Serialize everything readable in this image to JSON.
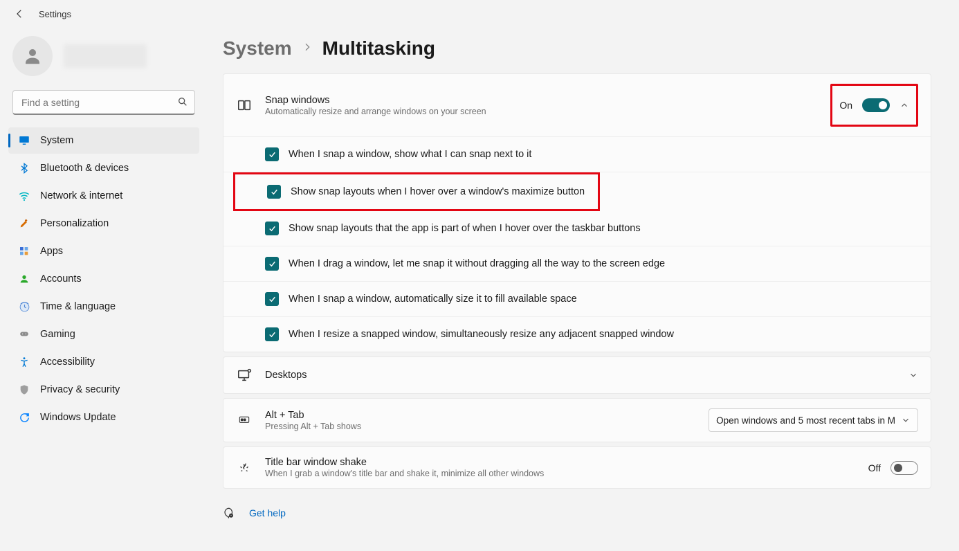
{
  "app_title": "Settings",
  "search_placeholder": "Find a setting",
  "breadcrumb": {
    "parent": "System",
    "current": "Multitasking"
  },
  "sidebar": {
    "items": [
      {
        "label": "System",
        "icon": "display-icon",
        "color": "#0078d4",
        "active": true
      },
      {
        "label": "Bluetooth & devices",
        "icon": "bluetooth-icon",
        "color": "#0078d4"
      },
      {
        "label": "Network & internet",
        "icon": "wifi-icon",
        "color": "#00b7c3"
      },
      {
        "label": "Personalization",
        "icon": "brush-icon",
        "color": "#d86c00"
      },
      {
        "label": "Apps",
        "icon": "apps-icon",
        "color": "#3a6fd8"
      },
      {
        "label": "Accounts",
        "icon": "person-icon",
        "color": "#2aa82a"
      },
      {
        "label": "Time & language",
        "icon": "clock-icon",
        "color": "#4f87d6"
      },
      {
        "label": "Gaming",
        "icon": "gamepad-icon",
        "color": "#8a8a8a"
      },
      {
        "label": "Accessibility",
        "icon": "accessibility-icon",
        "color": "#0078d4"
      },
      {
        "label": "Privacy & security",
        "icon": "shield-icon",
        "color": "#9e9e9e"
      },
      {
        "label": "Windows Update",
        "icon": "update-icon",
        "color": "#0a84ff"
      }
    ]
  },
  "snap": {
    "title": "Snap windows",
    "subtitle": "Automatically resize and arrange windows on your screen",
    "state_label": "On",
    "options": [
      "When I snap a window, show what I can snap next to it",
      "Show snap layouts when I hover over a window's maximize button",
      "Show snap layouts that the app is part of when I hover over the taskbar buttons",
      "When I drag a window, let me snap it without dragging all the way to the screen edge",
      "When I snap a window, automatically size it to fill available space",
      "When I resize a snapped window, simultaneously resize any adjacent snapped window"
    ]
  },
  "desktops": {
    "title": "Desktops"
  },
  "alttab": {
    "title": "Alt + Tab",
    "subtitle": "Pressing Alt + Tab shows",
    "dropdown_value": "Open windows and 5 most recent tabs in M"
  },
  "shake": {
    "title": "Title bar window shake",
    "subtitle": "When I grab a window's title bar and shake it, minimize all other windows",
    "state_label": "Off"
  },
  "gethelp": "Get help"
}
